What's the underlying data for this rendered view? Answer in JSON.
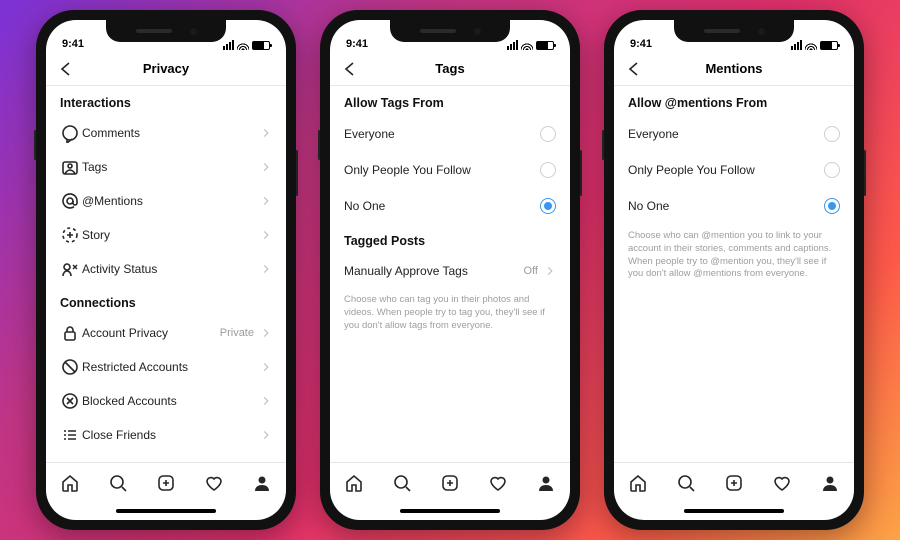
{
  "status_time": "9:41",
  "screens": [
    {
      "title": "Privacy",
      "sections": [
        {
          "header": "Interactions",
          "rows": [
            {
              "icon": "comment",
              "label": "Comments",
              "value": "",
              "name": "comments"
            },
            {
              "icon": "tag",
              "label": "Tags",
              "value": "",
              "name": "tags"
            },
            {
              "icon": "mention",
              "label": "@Mentions",
              "value": "",
              "name": "mentions"
            },
            {
              "icon": "story",
              "label": "Story",
              "value": "",
              "name": "story"
            },
            {
              "icon": "activity",
              "label": "Activity Status",
              "value": "",
              "name": "activity-status"
            }
          ]
        },
        {
          "header": "Connections",
          "rows": [
            {
              "icon": "lock",
              "label": "Account Privacy",
              "value": "Private",
              "name": "account-privacy"
            },
            {
              "icon": "restricted",
              "label": "Restricted Accounts",
              "value": "",
              "name": "restricted"
            },
            {
              "icon": "blocked",
              "label": "Blocked Accounts",
              "value": "",
              "name": "blocked"
            },
            {
              "icon": "closefriends",
              "label": "Close Friends",
              "value": "",
              "name": "close-friends"
            }
          ]
        }
      ]
    },
    {
      "title": "Tags",
      "radio_header": "Allow Tags From",
      "options": [
        {
          "label": "Everyone",
          "selected": false
        },
        {
          "label": "Only People You Follow",
          "selected": false
        },
        {
          "label": "No One",
          "selected": true
        }
      ],
      "extra_header": "Tagged Posts",
      "extra_row": {
        "label": "Manually Approve Tags",
        "value": "Off"
      },
      "helper": "Choose who can tag you in their photos and videos. When people try to tag you, they'll see if you don't allow tags from everyone."
    },
    {
      "title": "Mentions",
      "radio_header": "Allow @mentions From",
      "options": [
        {
          "label": "Everyone",
          "selected": false
        },
        {
          "label": "Only People You Follow",
          "selected": false
        },
        {
          "label": "No One",
          "selected": true
        }
      ],
      "helper": "Choose who can @mention you to link to your account in their stories, comments and captions. When people try to @mention you, they'll see if you don't allow @mentions from everyone."
    }
  ],
  "tabbar_icons": [
    "home",
    "search",
    "create",
    "activity-heart",
    "profile"
  ]
}
